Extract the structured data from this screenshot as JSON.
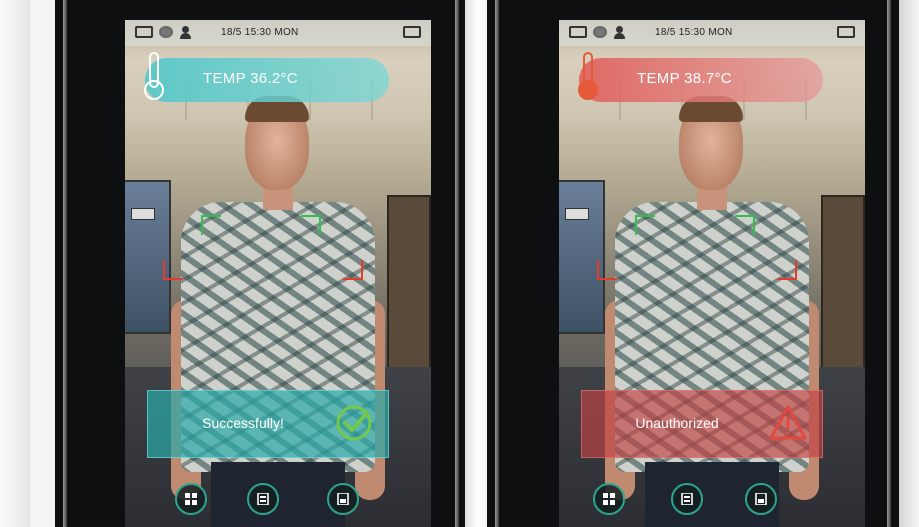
{
  "panels": [
    {
      "id": "left",
      "status_bar": {
        "datetime": "18/5 15:30 MON"
      },
      "temperature": {
        "label": "TEMP 36.2°C",
        "banner_color": "#58c8c8",
        "icon": "thermometer-icon"
      },
      "result": {
        "label": "Successfully!",
        "box_color": "#2aa9a8",
        "icon": "check-circle-icon",
        "icon_color": "#74c94a"
      },
      "bracket_color_top": "#2fbf4f",
      "bracket_color_side": "#e43b2b"
    },
    {
      "id": "right",
      "status_bar": {
        "datetime": "18/5 15:30 MON"
      },
      "temperature": {
        "label": "TEMP 38.7°C",
        "banner_color": "#e0706c",
        "icon": "thermometer-icon"
      },
      "result": {
        "label": "Unauthorized",
        "box_color": "#c24242",
        "icon": "warning-triangle-icon",
        "icon_color": "#e24a3f"
      },
      "bracket_color_top": "#2fbf4f",
      "bracket_color_side": "#e43b2b"
    }
  ],
  "bottom_buttons": [
    {
      "icon": "grid-icon"
    },
    {
      "icon": "id-card-icon"
    },
    {
      "icon": "document-icon"
    }
  ]
}
